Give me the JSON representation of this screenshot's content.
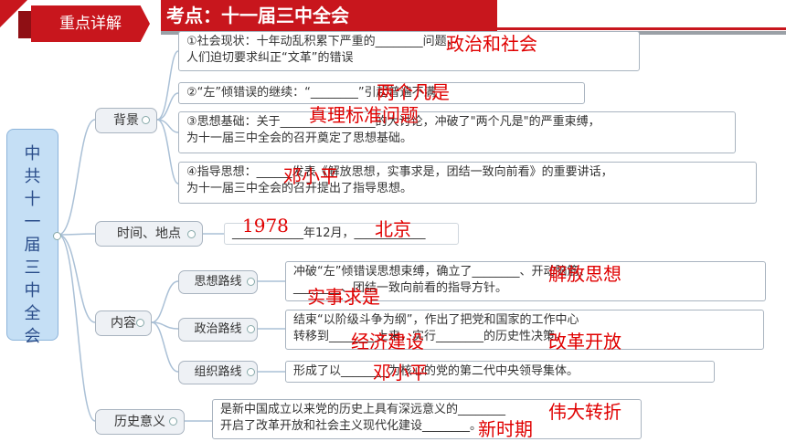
{
  "header": {
    "badge": "重点详解",
    "title": "考点：十一届三中全会"
  },
  "root": [
    "中",
    "共",
    "十",
    "一",
    "届",
    "三",
    "中",
    "全",
    "会"
  ],
  "branches": {
    "background": "背景",
    "time_place": "时间、地点",
    "content": "内容",
    "significance": "历史意义"
  },
  "leaves": {
    "bg1_line1": "①社会现状：十年动乱积累下严重的________问题，",
    "bg1_line2": "人们迫切要求纠正“文革”的错误",
    "bg2": "②“左”倾错误的继续：“________”引起普遍不满",
    "bg3_line1": "③思想基础：关于________________的大讨论，冲破了\"两个凡是\"的严重束缚，",
    "bg3_line2": "为十一届三中全会的召开奠定了思想基础。",
    "bg4_line1": "④指导思想：______发表《解放思想，实事求是，团结一致向前看》的重要讲话，",
    "bg4_line2": "为十一届三中全会的召开提出了指导思想。",
    "time_place": "____________年12月，____________",
    "c1_label": "思想路线",
    "c1_line1": "冲破“左”倾错误思想束缚，确立了________、开动脑筋、",
    "c1_line2": "________、团结一致向前看的指导方针。",
    "c2_label": "政治路线",
    "c2_line1": "结束“以阶级斗争为纲”，作出了把党和国家的工作中心",
    "c2_line2": "转移到________上来，实行________的历史性决策。",
    "c3_label": "组织路线",
    "c3_line1": "形成了以________为核心的党的第二代中央领导集体。",
    "sig_line1": "是新中国成立以来党的历史上具有深远意义的________",
    "sig_line2": "开启了改革开放和社会主义现代化建设________。"
  },
  "answers": {
    "a1": "政治和社会",
    "a2": "两个凡是",
    "a3": "真理标准问题",
    "a4": "邓小平",
    "a5": "1978",
    "a6": "北京",
    "a7": "解放思想",
    "a8": "实事求是",
    "a9": "经济建设",
    "a10": "改革开放",
    "a11": "邓小平",
    "a12": "伟大转折",
    "a13": "新时期"
  },
  "colors": {
    "accent_red": "#c8161d",
    "answer_red": "#e00000",
    "root_blue": "#c5dff5"
  }
}
